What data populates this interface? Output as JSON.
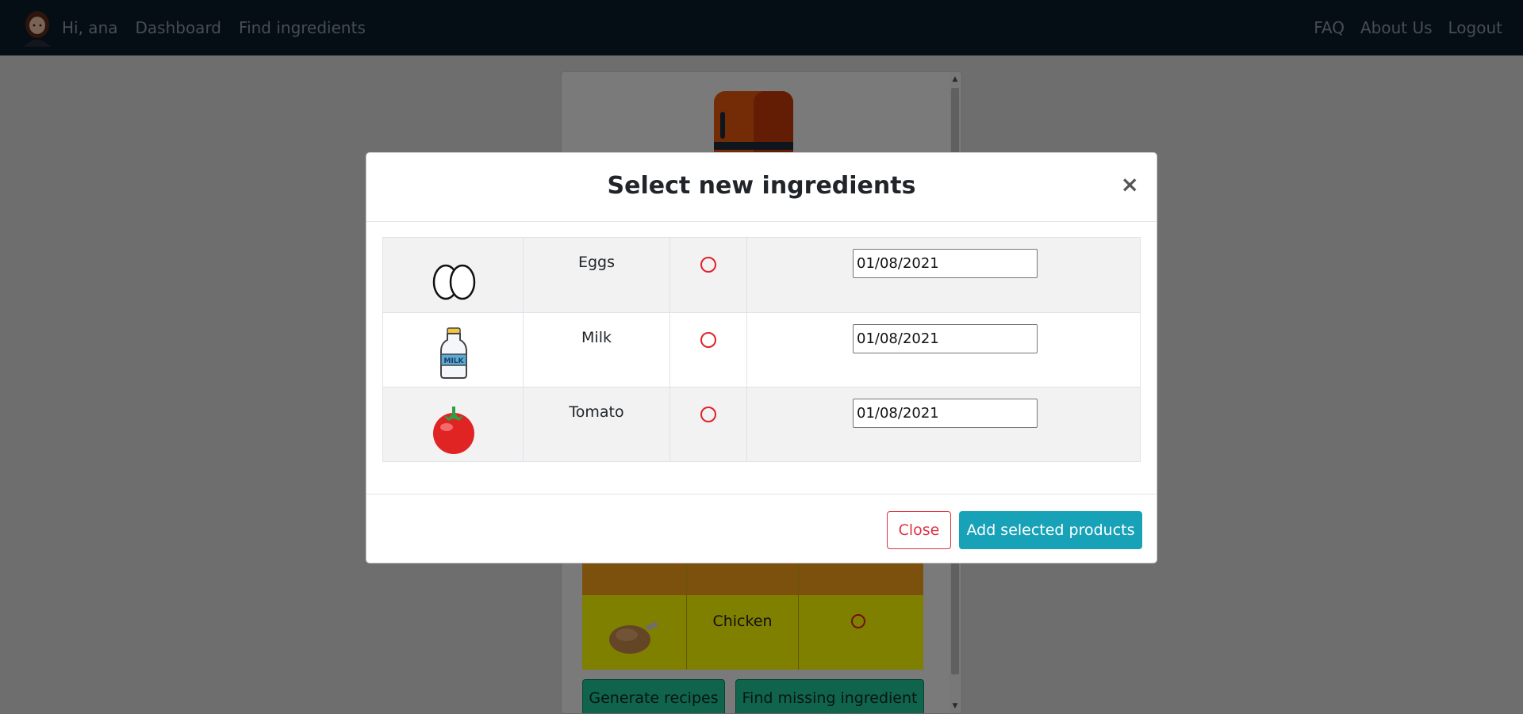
{
  "navbar": {
    "greeting": "Hi, ana",
    "links_left": [
      "Dashboard",
      "Find ingredients"
    ],
    "links_right": [
      "FAQ",
      "About Us",
      "Logout"
    ]
  },
  "background": {
    "rows": [
      {
        "name": "",
        "color": "#f7a21b"
      },
      {
        "name": "Chicken",
        "color": "#ffff00"
      }
    ],
    "buttons": [
      "Generate recipes",
      "Find missing ingredient"
    ]
  },
  "modal": {
    "title": "Select new ingredients",
    "close_symbol": "×",
    "ingredients": [
      {
        "name": "Eggs",
        "icon": "eggs-icon",
        "date": "01/08/2021"
      },
      {
        "name": "Milk",
        "icon": "milk-bottle-icon",
        "date": "01/08/2021"
      },
      {
        "name": "Tomato",
        "icon": "tomato-icon",
        "date": "01/08/2021"
      }
    ],
    "close_label": "Close",
    "add_label": "Add selected products"
  },
  "colors": {
    "navbar": "#0b1d2a",
    "primary_button": "#17a2b8",
    "danger": "#dc3545",
    "radio": "#e0202a",
    "secondary_button": "#20c997"
  }
}
